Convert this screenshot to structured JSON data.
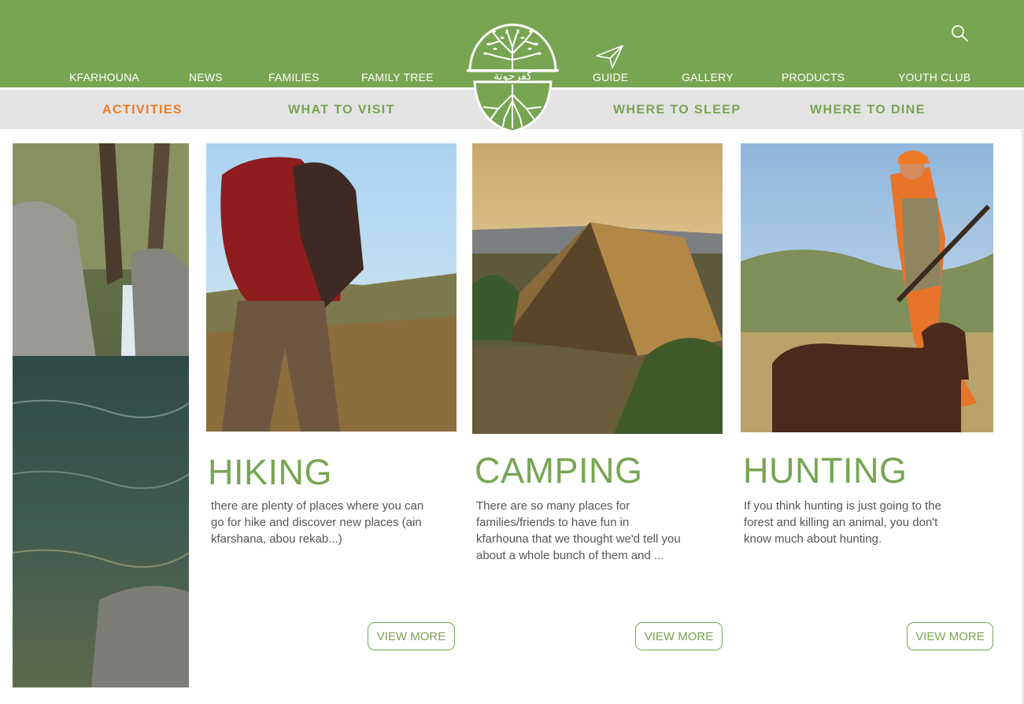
{
  "header": {
    "nav_left": [
      "KFARHOUNA",
      "NEWS",
      "FAMILIES",
      "FAMILY TREE"
    ],
    "nav_right": [
      "GUIDE",
      "GALLERY",
      "PRODUCTS",
      "YOUTH CLUB"
    ],
    "logo_text": "كفرحونة",
    "search_icon": "search-icon",
    "guide_icon": "paper-plane-icon"
  },
  "subnav": {
    "items": [
      "ACTIVITIES",
      "WHAT TO VISIT",
      "WHERE TO SLEEP",
      "WHERE TO DINE"
    ],
    "active": "ACTIVITIES"
  },
  "cards": [
    {
      "title": "HIKING",
      "text": "there are plenty of places where you can go for hike and discover new places (ain kfarshana, abou rekab...)",
      "button": "VIEW MORE"
    },
    {
      "title": "CAMPING",
      "text": "There are so many places for families/friends to have fun in kfarhouna that we thought we'd tell you about a whole bunch of them and ...",
      "button": "VIEW MORE"
    },
    {
      "title": "HUNTING",
      "text": "If you think hunting is just going to the forest and killing an animal, you don't know much about hunting.",
      "button": "VIEW MORE"
    }
  ],
  "colors": {
    "brand_green": "#78a552",
    "active_orange": "#f07a24",
    "subnav_green": "#78a552",
    "subnav_bg": "#e3e3e3"
  }
}
